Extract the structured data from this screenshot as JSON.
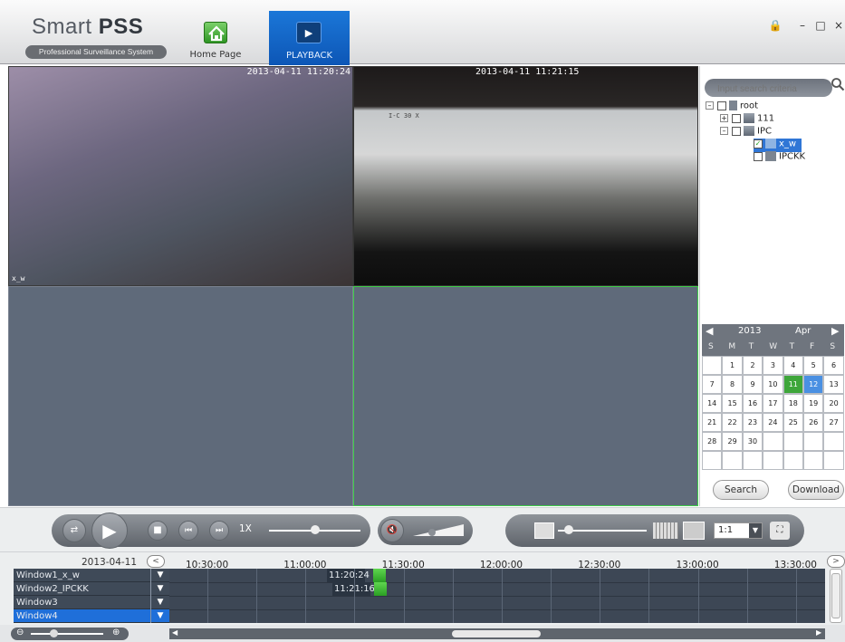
{
  "app": {
    "logo_brand": "Smart",
    "logo_product": "PSS",
    "logo_subtitle": "Professional Surveillance System",
    "tabs": [
      {
        "label": "Home Page",
        "icon": "home-icon"
      },
      {
        "label": "PLAYBACK",
        "icon": "playback-icon",
        "active": true
      }
    ],
    "window_controls": {
      "lock": "🔒",
      "minimize": "–",
      "maximize": "□",
      "close": "×"
    }
  },
  "video": {
    "panes": [
      {
        "timestamp": "2013-04-11 11:20:24",
        "channel_label": "x_w"
      },
      {
        "timestamp": "2013-04-11 11:21:15",
        "overlay": "I-C 30 X"
      },
      {
        "timestamp": ""
      },
      {
        "timestamp": ""
      }
    ],
    "selected_pane": 4
  },
  "sidebar": {
    "search_placeholder": "Input search criteria",
    "tree": [
      {
        "label": "root",
        "level": 0,
        "expanded": true,
        "checked": false
      },
      {
        "label": "111",
        "level": 1,
        "expanded": false,
        "checked": false
      },
      {
        "label": "IPC",
        "level": 1,
        "expanded": true,
        "checked": false
      },
      {
        "label": "x_w",
        "level": 2,
        "checked": true,
        "selected": true
      },
      {
        "label": "IPCKK",
        "level": 2,
        "checked": false
      }
    ],
    "calendar": {
      "year": "2013",
      "month": "Apr",
      "dows": [
        "S",
        "M",
        "T",
        "W",
        "T",
        "F",
        "S"
      ],
      "days": [
        "",
        "1",
        "2",
        "3",
        "4",
        "5",
        "6",
        "7",
        "8",
        "9",
        "10",
        "11",
        "12",
        "13",
        "14",
        "15",
        "16",
        "17",
        "18",
        "19",
        "20",
        "21",
        "22",
        "23",
        "24",
        "25",
        "26",
        "27",
        "28",
        "29",
        "30",
        "",
        "",
        "",
        "",
        "",
        "",
        "",
        "",
        "",
        "",
        ""
      ],
      "recorded_day": "11",
      "selected_day": "12"
    },
    "search_button": "Search",
    "download_button": "Download"
  },
  "controls": {
    "speed": "1X",
    "ratio": "1:1",
    "colors": {
      "accent": "#0d56b6",
      "green": "#3fcd4a"
    }
  },
  "timeline": {
    "date": "2013-04-11",
    "ticks": [
      "10:30:00",
      "11:00:00",
      "11:30:00",
      "12:00:00",
      "12:30:00",
      "13:00:00",
      "13:30:00"
    ],
    "rows": [
      {
        "label": "Window1_x_w",
        "record_start": "11:20:24"
      },
      {
        "label": "Window2_IPCKK",
        "record_start": "11:21:16"
      },
      {
        "label": "Window3",
        "record_start": ""
      },
      {
        "label": "Window4",
        "record_start": "",
        "selected": true
      }
    ]
  }
}
